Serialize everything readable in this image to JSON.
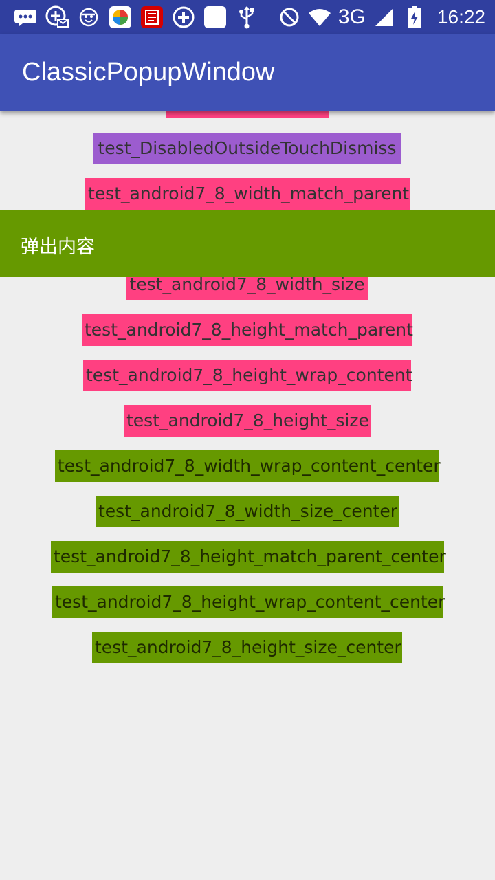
{
  "status_bar": {
    "left_icons": [
      "message-icon",
      "vpn-mail-icon",
      "face-icon",
      "app-store-icon",
      "news-app-icon",
      "add-circle-icon",
      "blank-square-icon",
      "usb-icon"
    ],
    "right_icons": [
      "do-not-disturb-icon",
      "wifi-icon",
      "signal-icon",
      "battery-charging-icon"
    ],
    "network": "3G",
    "time": "16:22"
  },
  "app_bar": {
    "title": "ClassicPopupWindow",
    "color": "#3F51B5"
  },
  "buttons": [
    {
      "label": "test_DisabledOutsideTouchDismiss",
      "color": "#9C5CCF"
    },
    {
      "label": "test_android7_8_width_match_parent",
      "color": "#FF4081"
    },
    {
      "label": "test_android7_8_width_size",
      "color": "#FF4081"
    },
    {
      "label": "test_android7_8_height_match_parent",
      "color": "#FF4081"
    },
    {
      "label": "test_android7_8_height_wrap_content",
      "color": "#FF4081"
    },
    {
      "label": "test_android7_8_height_size",
      "color": "#FF4081"
    },
    {
      "label": "test_android7_8_width_wrap_content_center",
      "color": "#669900"
    },
    {
      "label": "test_android7_8_width_size_center",
      "color": "#669900"
    },
    {
      "label": "test_android7_8_height_match_parent_center",
      "color": "#669900"
    },
    {
      "label": "test_android7_8_height_wrap_content_center",
      "color": "#669900"
    },
    {
      "label": "test_android7_8_height_size_center",
      "color": "#669900"
    }
  ],
  "popup": {
    "text": "弹出内容",
    "color": "#669900"
  }
}
